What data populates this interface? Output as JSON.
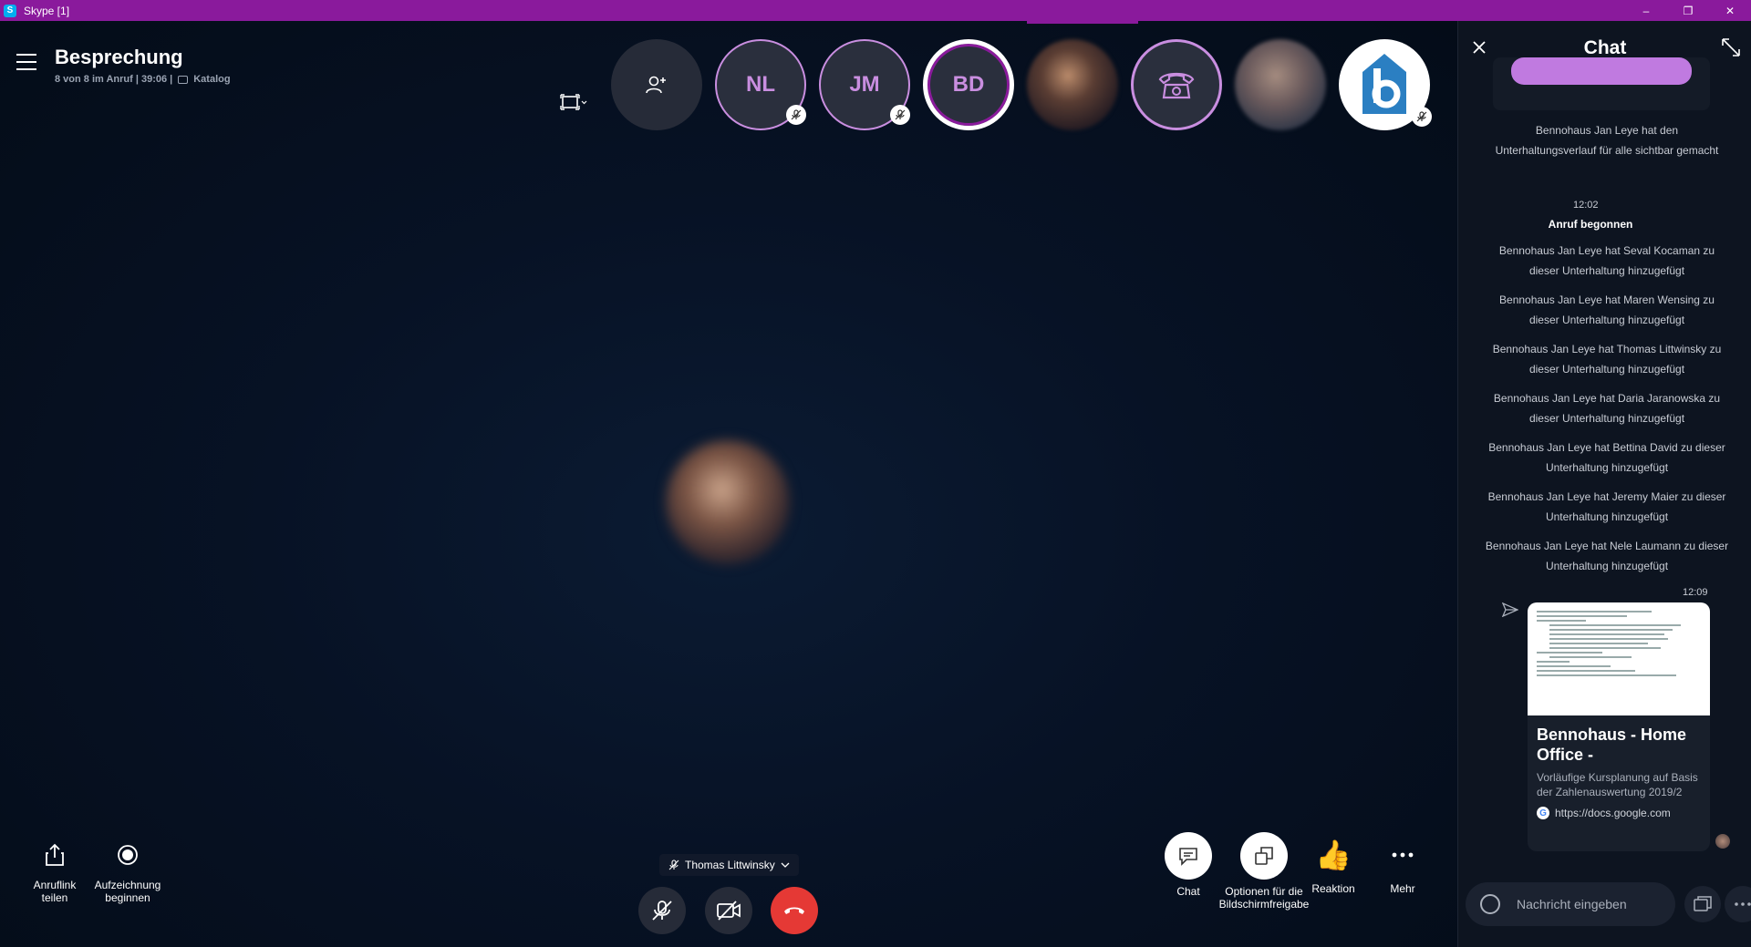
{
  "window": {
    "title": "Skype [1]",
    "app_icon_letter": "S",
    "minimize": "–",
    "restore": "❐",
    "close": "✕"
  },
  "call": {
    "title": "Besprechung",
    "subtitle": "8 von 8 im Anruf | 39:06 |",
    "folder_label": "Katalog",
    "participants": [
      {
        "initials": "NL",
        "muted": true
      },
      {
        "initials": "JM",
        "muted": true
      },
      {
        "initials": "BD",
        "muted": false,
        "active": true
      },
      {
        "initials": "",
        "photo": true
      },
      {
        "initials": "",
        "phone": true
      },
      {
        "initials": "",
        "photo": true
      },
      {
        "initials": "",
        "logo": true,
        "muted": true
      }
    ],
    "speaker_name": "Thomas Littwinsky",
    "controls": {
      "share_link": "Anruflink teilen",
      "record": "Aufzeichnung beginnen",
      "chat": "Chat",
      "screen_share": "Optionen für die Bildschirmfreigabe",
      "reaction": "Reaktion",
      "more": "Mehr"
    }
  },
  "chat": {
    "title": "Chat",
    "messages": [
      "Bennohaus Jan Leye hat den Unterhaltungsverlauf für alle sichtbar gemacht",
      "Bennohaus Jan Leye hat Seval Kocaman zu dieser Unterhaltung hinzugefügt",
      "Bennohaus Jan Leye hat Maren Wensing zu dieser Unterhaltung hinzugefügt",
      "Bennohaus Jan Leye hat Thomas Littwinsky zu dieser Unterhaltung hinzugefügt",
      "Bennohaus Jan Leye hat Daria Jaranowska zu dieser Unterhaltung hinzugefügt",
      "Bennohaus Jan Leye hat Bettina David zu dieser Unterhaltung hinzugefügt",
      "Bennohaus Jan Leye hat Jeremy Maier zu dieser Unterhaltung hinzugefügt",
      "Bennohaus Jan Leye hat Nele Laumann zu dieser Unterhaltung hinzugefügt"
    ],
    "time_call_start": "12:02",
    "call_started": "Anruf begonnen",
    "time_link": "12:09",
    "link_card": {
      "title": "Bennohaus - Home Office -",
      "description": "Vorläufige Kursplanung auf Basis der Zahlenauswertung 2019/2",
      "url": "https://docs.google.com",
      "url_icon_letter": "G"
    },
    "composer_placeholder": "Nachricht eingeben"
  },
  "colors": {
    "titlebar": "#8a1a9c",
    "accent": "#c98ee0",
    "end_call": "#e53935"
  }
}
